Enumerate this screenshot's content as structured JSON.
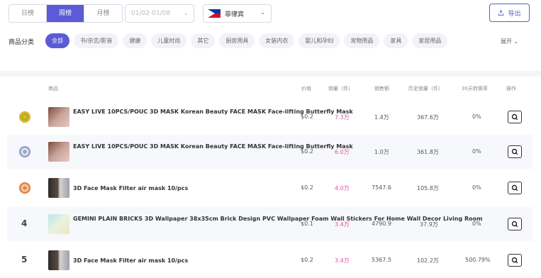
{
  "period_tabs": [
    "日榜",
    "周榜",
    "月榜"
  ],
  "active_period": "周榜",
  "date_range": "01/02-01/08",
  "country": "菲律宾",
  "export_label": "导出",
  "category_label": "商品分类",
  "categories": [
    "全部",
    "书/杂志/影音",
    "健康",
    "儿童时尚",
    "其它",
    "厨房用具",
    "女装内衣",
    "婴儿和孕妇",
    "宠物用品",
    "家具",
    "家居用品"
  ],
  "active_category": "全部",
  "expand_label": "展开",
  "columns": {
    "product": "商品",
    "price": "价格",
    "sales": "销量（件）",
    "revenue": "销售额",
    "history": "历史销量（件）",
    "conversion": "30天转换率",
    "action": "操作"
  },
  "rows": [
    {
      "rank": "",
      "medal": "gold",
      "title": "EASY LIVE 10PCS/POUC 3D MASK Korean Beauty FACE MASK Face-lifting Butterfly Mask",
      "price": "$0.2",
      "sales": "7.3万",
      "revenue": "1.4万",
      "history": "367.6万",
      "conversion": "0%"
    },
    {
      "rank": "",
      "medal": "silver",
      "title": "EASY LIVE 10PCS/POUC 3D MASK Korean Beauty FACE MASK Face-lifting Butterfly Mask",
      "price": "$0.2",
      "sales": "6.0万",
      "revenue": "1.0万",
      "history": "361.8万",
      "conversion": "0%"
    },
    {
      "rank": "",
      "medal": "bronze",
      "title": "3D Face Mask Filter air mask 10/pcs",
      "price": "$0.2",
      "sales": "4.0万",
      "revenue": "7547.6",
      "history": "105.8万",
      "conversion": "0%"
    },
    {
      "rank": "4",
      "medal": "",
      "title": "GEMINI PLAIN BRICKS 3D Wallpaper 38x35cm Brick Design PVC Wallpaper Foam Wall Stickers For Home Wall Decor Living Room",
      "price": "$0.1",
      "sales": "3.4万",
      "revenue": "4790.9",
      "history": "37.9万",
      "conversion": "0%"
    },
    {
      "rank": "5",
      "medal": "",
      "title": "3D Face Mask Filter air mask 10/pcs",
      "price": "$0.2",
      "sales": "3.4万",
      "revenue": "5367.5",
      "history": "102.2万",
      "conversion": "500.79%"
    }
  ],
  "colors": {
    "accent": "#5b5bd6",
    "sales": "#e0509c"
  }
}
